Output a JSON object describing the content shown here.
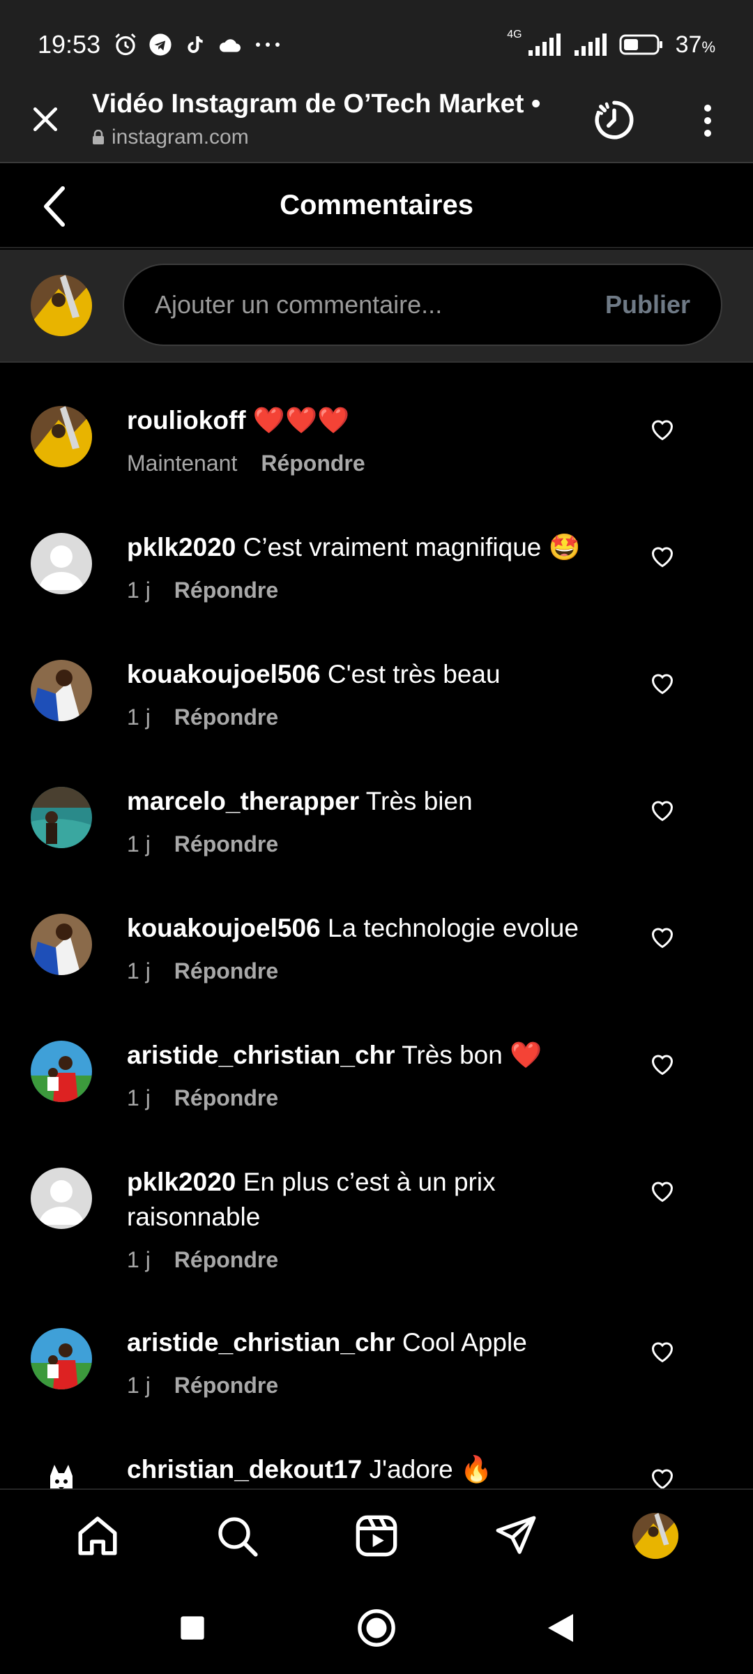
{
  "status_bar": {
    "time": "19:53",
    "network": "4G",
    "battery": "37",
    "battery_unit": "%"
  },
  "browser": {
    "title": "Vidéo Instagram de O’Tech Market •",
    "url": "instagram.com"
  },
  "header": {
    "title": "Commentaires"
  },
  "composer": {
    "placeholder": "Ajouter un commentaire...",
    "publish_label": "Publier"
  },
  "comments": [
    {
      "username": "rouliokoff",
      "text": "❤️❤️❤️",
      "time": "Maintenant",
      "reply": "Répondre",
      "avatar": "yellow"
    },
    {
      "username": "pklk2020",
      "text": "C’est vraiment magnifique 🤩",
      "time": "1 j",
      "reply": "Répondre",
      "avatar": "default"
    },
    {
      "username": "kouakoujoel506",
      "text": "C'est très beau",
      "time": "1 j",
      "reply": "Répondre",
      "avatar": "blue"
    },
    {
      "username": "marcelo_therapper",
      "text": "Très bien",
      "time": "1 j",
      "reply": "Répondre",
      "avatar": "teal"
    },
    {
      "username": "kouakoujoel506",
      "text": "La technologie evolue",
      "time": "1 j",
      "reply": "Répondre",
      "avatar": "blue"
    },
    {
      "username": "aristide_christian_chr",
      "text": "Très bon ❤️",
      "time": "1 j",
      "reply": "Répondre",
      "avatar": "green"
    },
    {
      "username": "pklk2020",
      "text": "En plus c’est à un prix raisonnable",
      "time": "1 j",
      "reply": "Répondre",
      "avatar": "default"
    },
    {
      "username": "aristide_christian_chr",
      "text": "Cool Apple",
      "time": "1 j",
      "reply": "Répondre",
      "avatar": "green"
    },
    {
      "username": "christian_dekout17",
      "text": "J'adore 🔥",
      "time": "",
      "reply": "",
      "avatar": "dog"
    }
  ],
  "icons": {
    "close": "close-icon",
    "history": "history-icon",
    "menu": "more-vert-icon",
    "back": "back-icon",
    "like": "heart-icon",
    "home": "home-icon",
    "search": "search-icon",
    "reels": "reels-icon",
    "direct": "send-icon"
  },
  "colors": {
    "background": "#000000",
    "toolbar": "#202020",
    "muted_text": "#a8a8a8",
    "publish_disabled": "#6f7a86"
  }
}
